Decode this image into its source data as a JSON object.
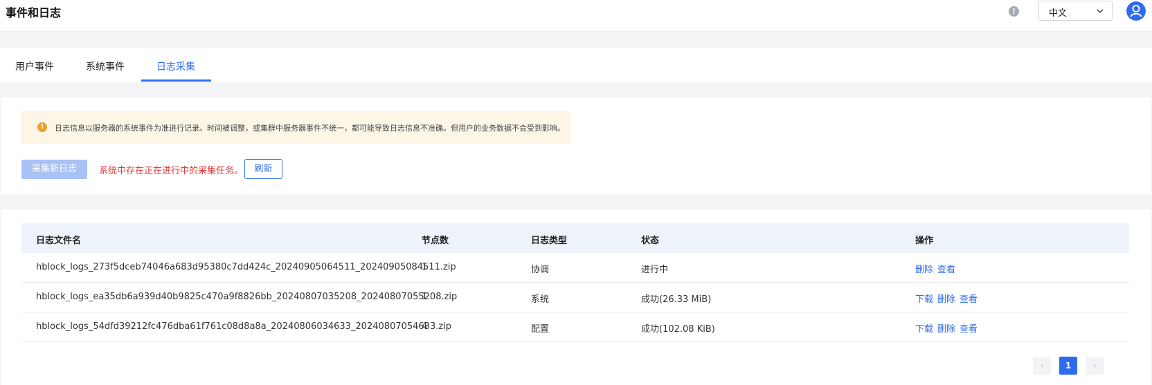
{
  "header": {
    "title": "事件和日志",
    "language": {
      "selected": "中文"
    }
  },
  "tabs": [
    {
      "label": "用户事件"
    },
    {
      "label": "系统事件"
    },
    {
      "label": "日志采集",
      "active": true
    }
  ],
  "notice": {
    "text": "日志信息以服务器的系统事件为准进行记录。时间被调整，或集群中服务器事件不统一，都可能导致日志信息不准确。但用户的业务数据不会受到影响。"
  },
  "toolbar": {
    "collect_label": "采集新日志",
    "warning": "系统中存在正在进行中的采集任务。",
    "refresh_label": "刷新"
  },
  "table": {
    "columns": [
      "日志文件名",
      "节点数",
      "日志类型",
      "状态",
      "操作"
    ],
    "rows": [
      {
        "filename": "hblock_logs_273f5dceb74046a683d95380c7dd424c_20240905064511_20240905084511.zip",
        "nodes": "1",
        "type": "协调",
        "status": "进行中",
        "actions": [
          "删除",
          "查看"
        ]
      },
      {
        "filename": "hblock_logs_ea35db6a939d40b9825c470a9f8826bb_20240807035208_20240807055208.zip",
        "nodes": "1",
        "type": "系统",
        "status": "成功(26.33 MiB)",
        "actions": [
          "下载",
          "删除",
          "查看"
        ]
      },
      {
        "filename": "hblock_logs_54dfd39212fc476dba61f761c08d8a8a_20240806034633_20240807054633.zip",
        "nodes": "4",
        "type": "配置",
        "status": "成功(102.08 KiB)",
        "actions": [
          "下载",
          "删除",
          "查看"
        ]
      }
    ]
  },
  "pagination": {
    "prev": "‹",
    "current": "1",
    "next": "›"
  },
  "colors": {
    "accent": "#2f6bf0",
    "warning_text": "#e53935",
    "alert_bg": "#fdf6e6"
  }
}
